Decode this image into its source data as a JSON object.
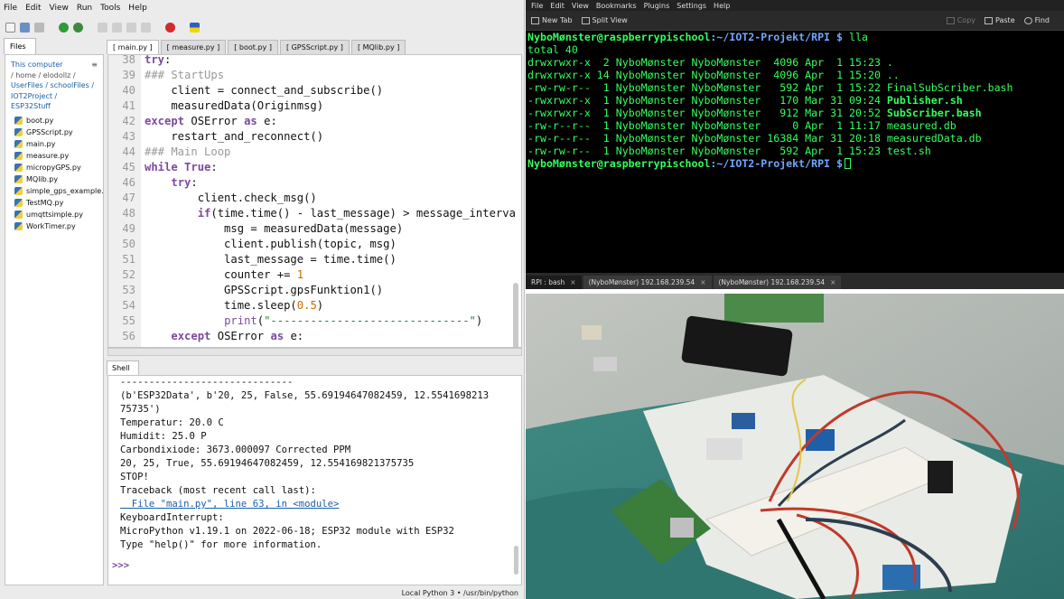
{
  "ide": {
    "menu": [
      "File",
      "Edit",
      "View",
      "Run",
      "Tools",
      "Help"
    ],
    "files_tab": "Files",
    "files_header": {
      "location": "This computer",
      "path_parts": [
        "/ home / elodollz /",
        "UserFiles / schoolFiles /",
        "IOT2Project /",
        "ESP32Stuff"
      ],
      "star": "≡"
    },
    "files": [
      "boot.py",
      "GPSScript.py",
      "main.py",
      "measure.py",
      "micropyGPS.py",
      "MQlib.py",
      "simple_gps_example.py",
      "TestMQ.py",
      "umqttsimple.py",
      "WorkTimer.py"
    ],
    "editor_tabs": [
      "[ main.py ]",
      "[ measure.py ]",
      "[ boot.py ]",
      "[ GPSScript.py ]",
      "[ MQlib.py ]"
    ],
    "code": [
      {
        "n": "38",
        "t": "try:"
      },
      {
        "n": "39",
        "t": "### StartUps"
      },
      {
        "n": "40",
        "t": "    client = connect_and_subscribe()"
      },
      {
        "n": "41",
        "t": "    measuredData(Originmsg)"
      },
      {
        "n": "42",
        "t": "except OSError as e:"
      },
      {
        "n": "43",
        "t": "    restart_and_reconnect()"
      },
      {
        "n": "44",
        "t": "### Main Loop"
      },
      {
        "n": "45",
        "t": "while True:"
      },
      {
        "n": "46",
        "t": "    try:"
      },
      {
        "n": "47",
        "t": "        client.check_msg()"
      },
      {
        "n": "48",
        "t": "        if(time.time() - last_message) > message_interva"
      },
      {
        "n": "49",
        "t": "            msg = measuredData(message)"
      },
      {
        "n": "50",
        "t": "            client.publish(topic, msg)"
      },
      {
        "n": "51",
        "t": "            last_message = time.time()"
      },
      {
        "n": "52",
        "t": "            counter += 1"
      },
      {
        "n": "53",
        "t": "            GPSScript.gpsFunktion1()"
      },
      {
        "n": "54",
        "t": "            time.sleep(0.5)"
      },
      {
        "n": "55",
        "t": "            print(\"------------------------------\")"
      },
      {
        "n": "56",
        "t": "    except OSError as e:"
      }
    ],
    "shell_tab": "Shell",
    "shell_lines": [
      "------------------------------",
      "(b'ESP32Data', b'20, 25, False, 55.69194647082459, 12.5541698213",
      "75735')",
      "Temperatur: 20.0 C",
      "Humidit: 25.0 P",
      "Carbondixiode: 3673.000097 Corrected PPM",
      "20, 25, True, 55.69194647082459, 12.554169821375735",
      "STOP!",
      "Traceback (most recent call last):",
      "  File \"main.py\", line 63, in <module>",
      "KeyboardInterrupt:",
      "MicroPython v1.19.1 on 2022-06-18; ESP32 module with ESP32",
      "Type \"help()\" for more information."
    ],
    "shell_prompt": ">>>",
    "status": "Local Python 3 • /usr/bin/python"
  },
  "terminal": {
    "menu": [
      "File",
      "Edit",
      "View",
      "Bookmarks",
      "Plugins",
      "Settings",
      "Help"
    ],
    "new_tab": "New Tab",
    "split_view": "Split View",
    "copy": "Copy",
    "paste": "Paste",
    "find": "Find",
    "prompt_user": "NyboMønster@raspberrypischool",
    "prompt_path": ":~/IOT2-Projekt/RPI $",
    "command": " lla",
    "total": "total 40",
    "listing": [
      {
        "perm": "drwxrwxr-x",
        "links": " 2",
        "owner": "NyboMønster NyboMønster",
        "size": " 4096",
        "date": "Apr  1 15:23",
        "name": ".",
        "bold": false
      },
      {
        "perm": "drwxrwxr-x",
        "links": "14",
        "owner": "NyboMønster NyboMønster",
        "size": " 4096",
        "date": "Apr  1 15:20",
        "name": "..",
        "bold": false
      },
      {
        "perm": "-rw-rw-r--",
        "links": " 1",
        "owner": "NyboMønster NyboMønster",
        "size": "  592",
        "date": "Apr  1 15:22",
        "name": "FinalSubScriber.bash",
        "bold": false
      },
      {
        "perm": "-rwxrwxr-x",
        "links": " 1",
        "owner": "NyboMønster NyboMønster",
        "size": "  170",
        "date": "Mar 31 09:24",
        "name": "Publisher.sh",
        "bold": true
      },
      {
        "perm": "-rwxrwxr-x",
        "links": " 1",
        "owner": "NyboMønster NyboMønster",
        "size": "  912",
        "date": "Mar 31 20:52",
        "name": "SubScriber.bash",
        "bold": true
      },
      {
        "perm": "-rw-r--r--",
        "links": " 1",
        "owner": "NyboMønster NyboMønster",
        "size": "    0",
        "date": "Apr  1 11:17",
        "name": "measured.db",
        "bold": false
      },
      {
        "perm": "-rw-r--r--",
        "links": " 1",
        "owner": "NyboMønster NyboMønster",
        "size": "16384",
        "date": "Mar 31 20:18",
        "name": "measuredData.db",
        "bold": false
      },
      {
        "perm": "-rw-rw-r--",
        "links": " 1",
        "owner": "NyboMønster NyboMønster",
        "size": "  592",
        "date": "Apr  1 15:23",
        "name": "test.sh",
        "bold": false
      }
    ],
    "tabs": [
      {
        "label": "RPI : bash",
        "close": "×"
      },
      {
        "label": "(NyboMønster) 192.168.239.54",
        "close": "×"
      },
      {
        "label": "(NyboMønster) 192.168.239.54",
        "close": "×"
      }
    ]
  },
  "colors": {
    "terminal_text": "#33ff5c",
    "terminal_bg": "#000000",
    "keyword": "#7c4a9e",
    "comment": "#9a9a9a",
    "number": "#c36b00",
    "string": "#2e7d32",
    "link": "#1a5fa8"
  }
}
